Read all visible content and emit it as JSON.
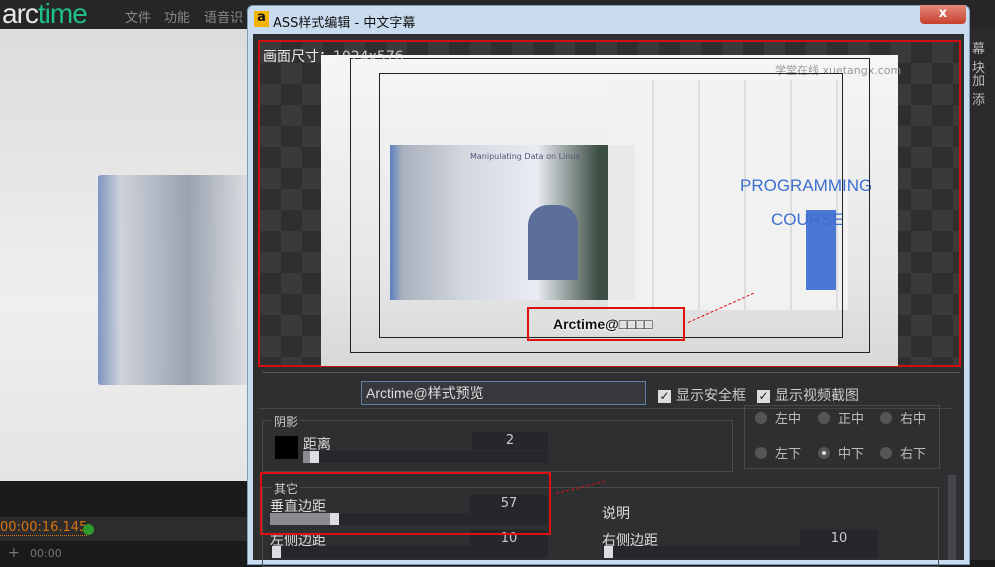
{
  "app": {
    "logo_prefix": "arc",
    "logo_accent": "time",
    "menu": [
      "文件",
      "功能",
      "语音识"
    ],
    "right_labels": [
      "幕块",
      "加添"
    ],
    "timecode": "00:00:16.145",
    "ruler_label": "00:00",
    "add_label": "+"
  },
  "dialog": {
    "icon_label": "a",
    "title": "ASS样式编辑 - 中文字幕",
    "close_label": "x",
    "preview": {
      "size_label": "画面尺寸：",
      "size_value": "1024x576",
      "subtitle": "Arctime@□□□□",
      "watermark": "学堂在线 xuetangx.com",
      "video_text_1": "PROGRAMMING",
      "video_text_2": "COURSE",
      "slide_title": "Manipulating Data on Linux"
    },
    "preview_text_input": "Arctime@样式预览",
    "show_safe_frame": {
      "label": "显示安全框",
      "checked": true
    },
    "show_video_snapshot": {
      "label": "显示视频截图",
      "checked": true
    },
    "shadow": {
      "group_label": "阴影",
      "distance_label": "距离",
      "distance_value": "2",
      "distance_fraction": 0.05,
      "color": "#000000"
    },
    "alignment": {
      "options": [
        "左中",
        "正中",
        "右中",
        "左下",
        "中下",
        "右下"
      ],
      "selected": "中下"
    },
    "other": {
      "group_label": "其它",
      "vertical_margin_label": "垂直边距",
      "vertical_margin_value": "57",
      "vertical_margin_fraction": 0.24,
      "left_margin_label": "左侧边距",
      "left_margin_value": "10",
      "left_margin_fraction": 0.04,
      "right_margin_label": "右侧边距",
      "right_margin_value": "10",
      "right_margin_fraction": 0.04,
      "description_label": "说明"
    }
  },
  "colors": {
    "accent": "#1fbf8a",
    "highlight": "#e01010",
    "timecode": "#d9730f"
  }
}
